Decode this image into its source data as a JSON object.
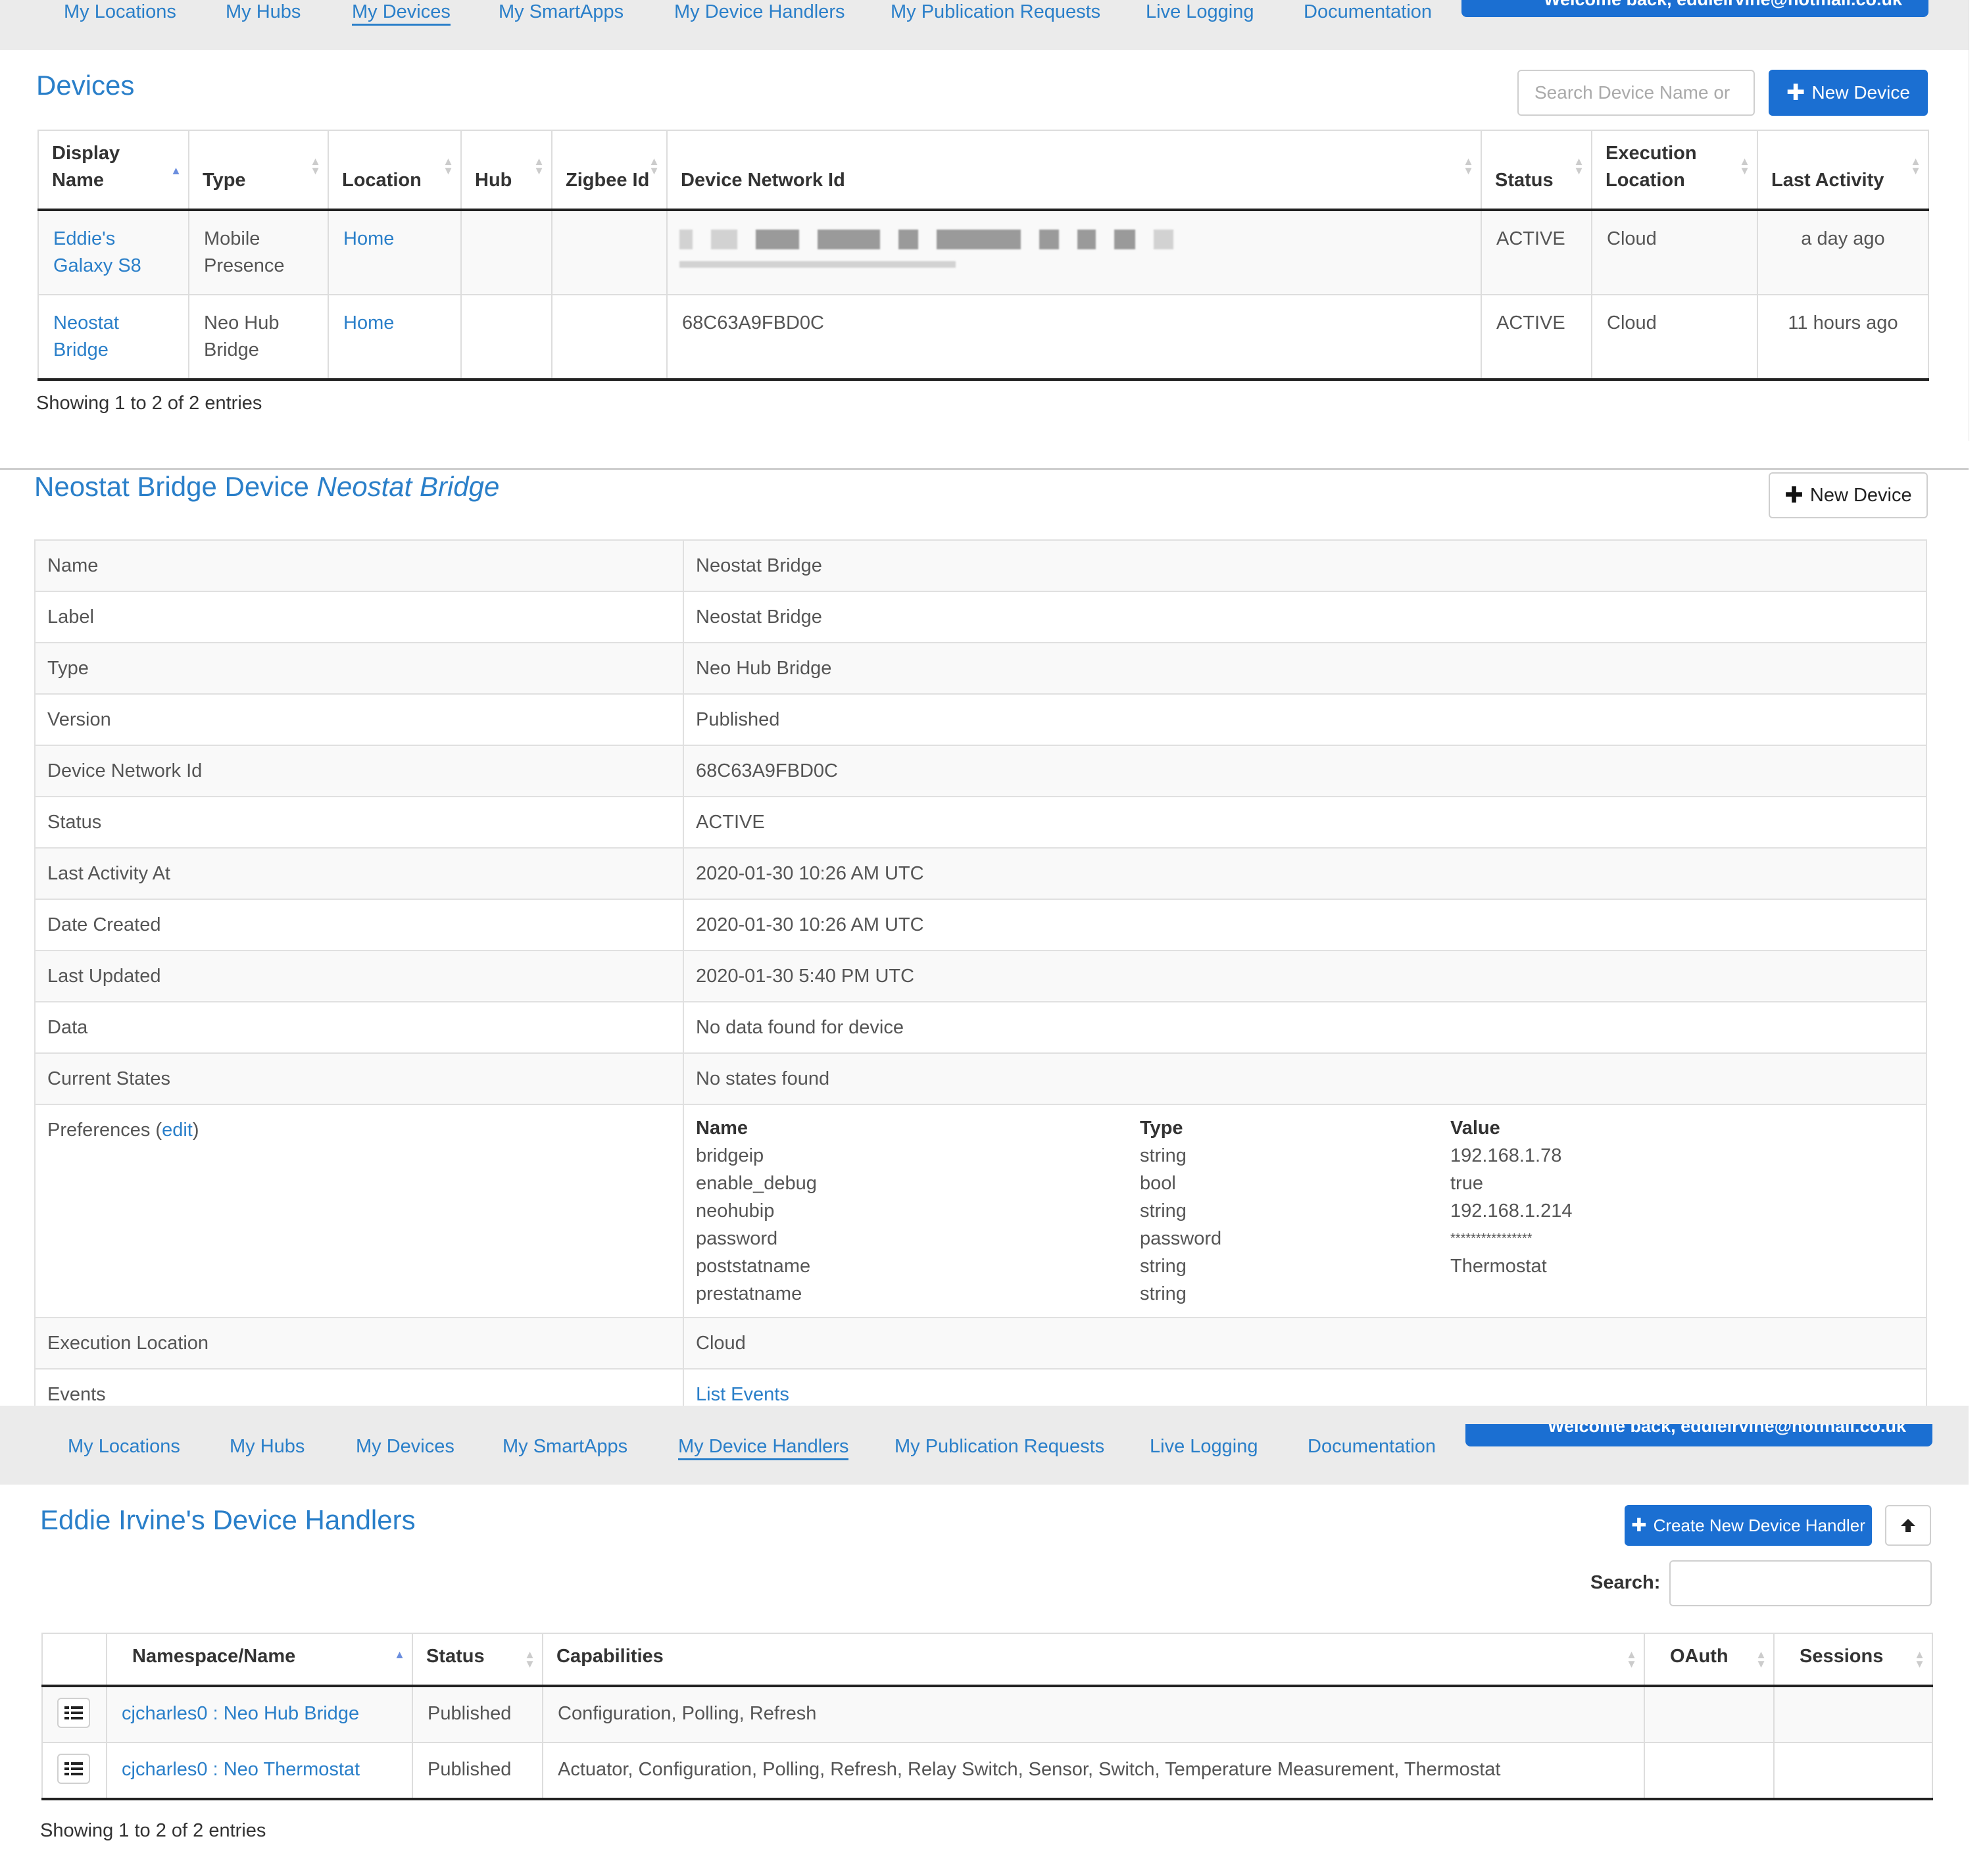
{
  "nav": {
    "items": [
      "My Locations",
      "My Hubs",
      "My Devices",
      "My SmartApps",
      "My Device Handlers",
      "My Publication Requests",
      "Live Logging",
      "Documentation"
    ],
    "welcome": "Welcome back, eddieirvine@hotmail.co.uk"
  },
  "devices": {
    "title": "Devices",
    "search_placeholder": "Search Device Name or",
    "new_button": "New Device",
    "columns": [
      "Display Name",
      "Type",
      "Location",
      "Hub",
      "Zigbee Id",
      "Device Network Id",
      "Status",
      "Execution Location",
      "Last Activity"
    ],
    "rows": [
      {
        "name": "Eddie's Galaxy S8",
        "type": "Mobile Presence",
        "location": "Home",
        "hub": "",
        "zigbee": "",
        "network_id": "",
        "status": "ACTIVE",
        "exec": "Cloud",
        "last": "a day ago"
      },
      {
        "name": "Neostat Bridge",
        "type": "Neo Hub Bridge",
        "location": "Home",
        "hub": "",
        "zigbee": "",
        "network_id": "68C63A9FBD0C",
        "status": "ACTIVE",
        "exec": "Cloud",
        "last": "11 hours ago"
      }
    ],
    "footer": "Showing 1 to 2 of 2 entries"
  },
  "detail": {
    "title_prefix": "Neostat Bridge Device",
    "title_name": "Neostat Bridge",
    "new_button": "New Device",
    "rows": [
      {
        "k": "Name",
        "v": "Neostat Bridge"
      },
      {
        "k": "Label",
        "v": "Neostat Bridge"
      },
      {
        "k": "Type",
        "v": "Neo Hub Bridge"
      },
      {
        "k": "Version",
        "v": "Published"
      },
      {
        "k": "Device Network Id",
        "v": "68C63A9FBD0C"
      },
      {
        "k": "Status",
        "v": "ACTIVE"
      },
      {
        "k": "Last Activity At",
        "v": "2020-01-30 10:26 AM UTC"
      },
      {
        "k": "Date Created",
        "v": "2020-01-30 10:26 AM UTC"
      },
      {
        "k": "Last Updated",
        "v": "2020-01-30 5:40 PM UTC"
      },
      {
        "k": "Data",
        "v": "No data found for device"
      },
      {
        "k": "Current States",
        "v": "No states found"
      }
    ],
    "preferences_label": "Preferences (",
    "preferences_edit": "edit",
    "preferences_close": ")",
    "pref_headers": [
      "Name",
      "Type",
      "Value"
    ],
    "prefs": [
      {
        "name": "bridgeip",
        "type": "string",
        "value": "192.168.1.78"
      },
      {
        "name": "enable_debug",
        "type": "bool",
        "value": "true"
      },
      {
        "name": "neohubip",
        "type": "string",
        "value": "192.168.1.214"
      },
      {
        "name": "password",
        "type": "password",
        "value": "****************"
      },
      {
        "name": "poststatname",
        "type": "string",
        "value": "Thermostat"
      },
      {
        "name": "prestatname",
        "type": "string",
        "value": ""
      }
    ],
    "exec_label": "Execution Location",
    "exec_value": "Cloud",
    "events_label": "Events",
    "events_link": "List Events"
  },
  "handlers": {
    "title": "Eddie Irvine's Device Handlers",
    "create_button": "Create New Device Handler",
    "search_label": "Search:",
    "columns": [
      "",
      "Namespace/Name",
      "Status",
      "Capabilities",
      "OAuth",
      "Sessions"
    ],
    "rows": [
      {
        "name": "cjcharles0 : Neo Hub Bridge",
        "status": "Published",
        "caps": "Configuration, Polling, Refresh",
        "oauth": "",
        "sessions": ""
      },
      {
        "name": "cjcharles0 : Neo Thermostat",
        "status": "Published",
        "caps": "Actuator, Configuration, Polling, Refresh, Relay Switch, Sensor, Switch, Temperature Measurement, Thermostat",
        "oauth": "",
        "sessions": ""
      }
    ],
    "footer": "Showing 1 to 2 of 2 entries"
  }
}
